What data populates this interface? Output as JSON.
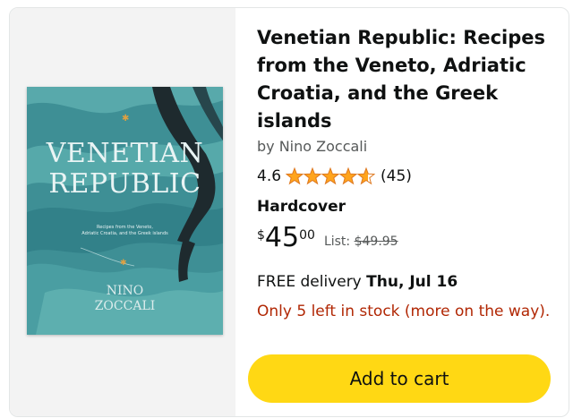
{
  "product": {
    "title": "Venetian Republic: Recipes from the Veneto, Adriatic Croatia, and the Greek islands",
    "byline": "by Nino Zoccali",
    "rating": "4.6",
    "rating_value": 4.6,
    "rating_max": 5,
    "review_count": "(45)",
    "format": "Hardcover",
    "price_currency": "$",
    "price_whole": "45",
    "price_fraction": "00",
    "list_label": "List:",
    "list_price": "$49.95",
    "delivery_prefix": "FREE delivery",
    "delivery_date": "Thu, Jul 16",
    "stock": "Only 5 left in stock (more on the way).",
    "add_to_cart": "Add to cart"
  },
  "cover": {
    "title_line1": "VENETIAN",
    "title_line2": "REPUBLIC",
    "subtitle_line1": "Recipes from the Veneto,",
    "subtitle_line2": "Adriatic Croatia, and the Greek islands",
    "author_line1": "NINO",
    "author_line2": "ZOCCALI"
  },
  "colors": {
    "star": "#ffa41c",
    "button": "#ffd814",
    "stock": "#b12704",
    "cover_teal": "#3e8f95"
  }
}
